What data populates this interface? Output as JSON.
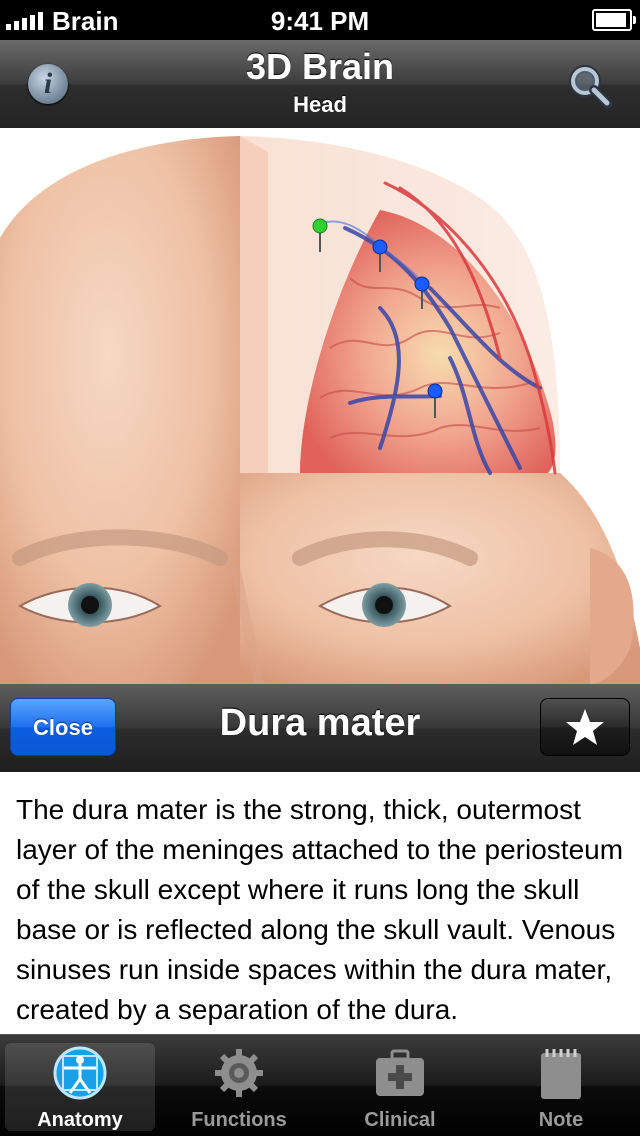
{
  "status_bar": {
    "carrier": "Brain",
    "time": "9:41 PM"
  },
  "nav": {
    "title": "3D Brain",
    "subtitle": "Head",
    "info_icon": "info-icon",
    "search_icon": "search-icon"
  },
  "detail": {
    "close_label": "Close",
    "title": "Dura mater",
    "favorite_icon": "star-icon",
    "description": "The dura mater is the strong, thick, outermost layer of the meninges attached to the periosteum of the skull except where it runs long the skull base or is reflected along the skull vault. Venous sinuses run inside spaces within the dura mater, created by a separation of the dura."
  },
  "tabs": [
    {
      "label": "Anatomy",
      "icon": "vitruvian-man-icon",
      "active": true
    },
    {
      "label": "Functions",
      "icon": "gear-icon",
      "active": false
    },
    {
      "label": "Clinical",
      "icon": "medical-kit-icon",
      "active": false
    },
    {
      "label": "Note",
      "icon": "notepad-icon",
      "active": false
    }
  ],
  "colors": {
    "close_button": "#1f6ff0",
    "pin_green": "#2fd02f",
    "pin_blue": "#1a5cff"
  }
}
